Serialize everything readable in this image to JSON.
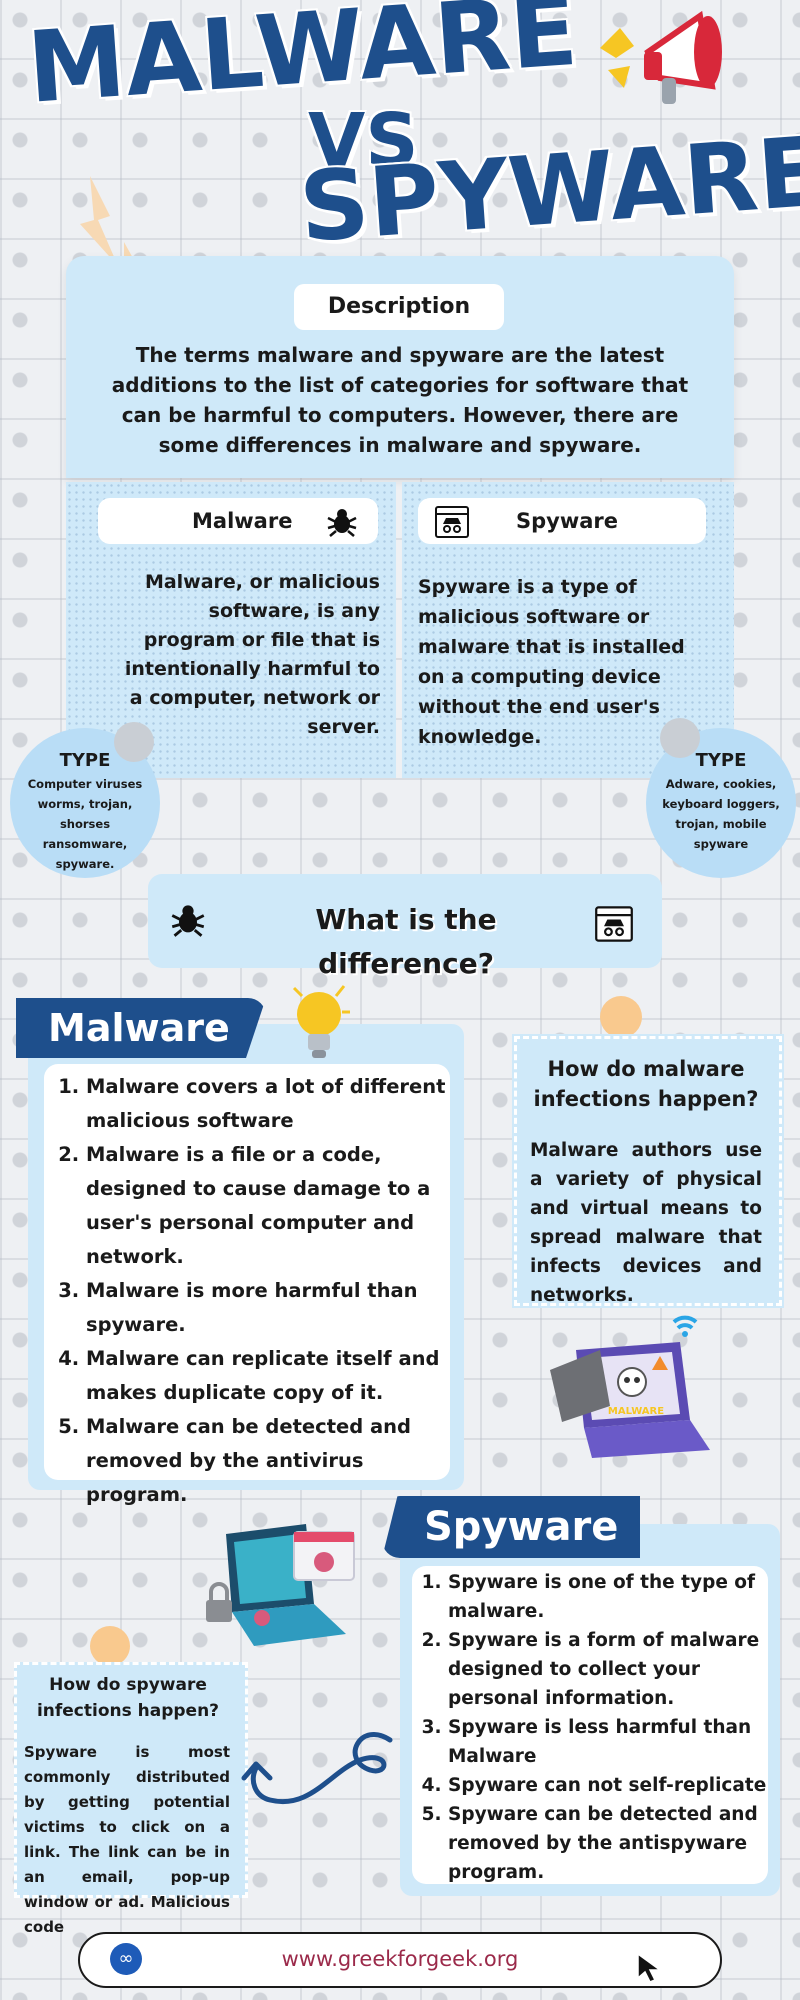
{
  "title": {
    "line1": "MALWARE",
    "line2": "VS",
    "line3": "SPYWARE"
  },
  "description": {
    "heading": "Description",
    "text": "The terms malware and spyware are the latest additions to the list of categories for software that can be harmful to computers. However, there are some differences in malware and spyware."
  },
  "compare": {
    "malware_label": "Malware",
    "spyware_label": "Spyware",
    "malware_definition": "Malware, or malicious software, is any program or file that is intentionally harmful to a computer, network or server.",
    "spyware_definition": "Spyware is a type of malicious software or malware that is installed on a computing device without the end user's knowledge."
  },
  "types": {
    "left_title": "TYPE",
    "left_text": "Computer viruses worms, trojan, shorses ransomware, spyware.",
    "right_title": "TYPE",
    "right_text": "Adware, cookies, keyboard loggers, trojan, mobile spyware"
  },
  "difference": {
    "title": "What is the difference?"
  },
  "malware_section": {
    "banner": "Malware",
    "points": [
      "Malware covers a lot of different malicious software",
      "Malware is a file or a code, designed to cause damage to a user's personal computer and network.",
      "Malware is more harmful than spyware.",
      "Malware can replicate itself and makes duplicate copy of it.",
      "Malware can be detected and removed by the antivirus program."
    ],
    "how_title": "How do malware infections happen?",
    "how_text": "Malware authors use a variety of physical and virtual means to spread malware that infects devices and networks.",
    "laptop_label": "MALWARE"
  },
  "spyware_section": {
    "banner": "Spyware",
    "points": [
      "Spyware is one of the type of malware.",
      "Spyware is a form of malware designed to collect your personal information.",
      "Spyware is less harmful than Malware",
      "Spyware can not self-replicate",
      "Spyware can be detected and removed by the antispyware program."
    ],
    "how_title": "How do spyware infections happen?",
    "how_text": "Spyware is most commonly distributed by getting potential victims to click on a link. The link can be in an email, pop-up window or ad. Malicious code"
  },
  "footer": {
    "url": "www.greekforgeek.org"
  },
  "colors": {
    "navy": "#1e4f8c",
    "panel_blue": "#cfe9f9",
    "circle_blue": "#b9ddf6",
    "url_color": "#9b2a4a"
  }
}
